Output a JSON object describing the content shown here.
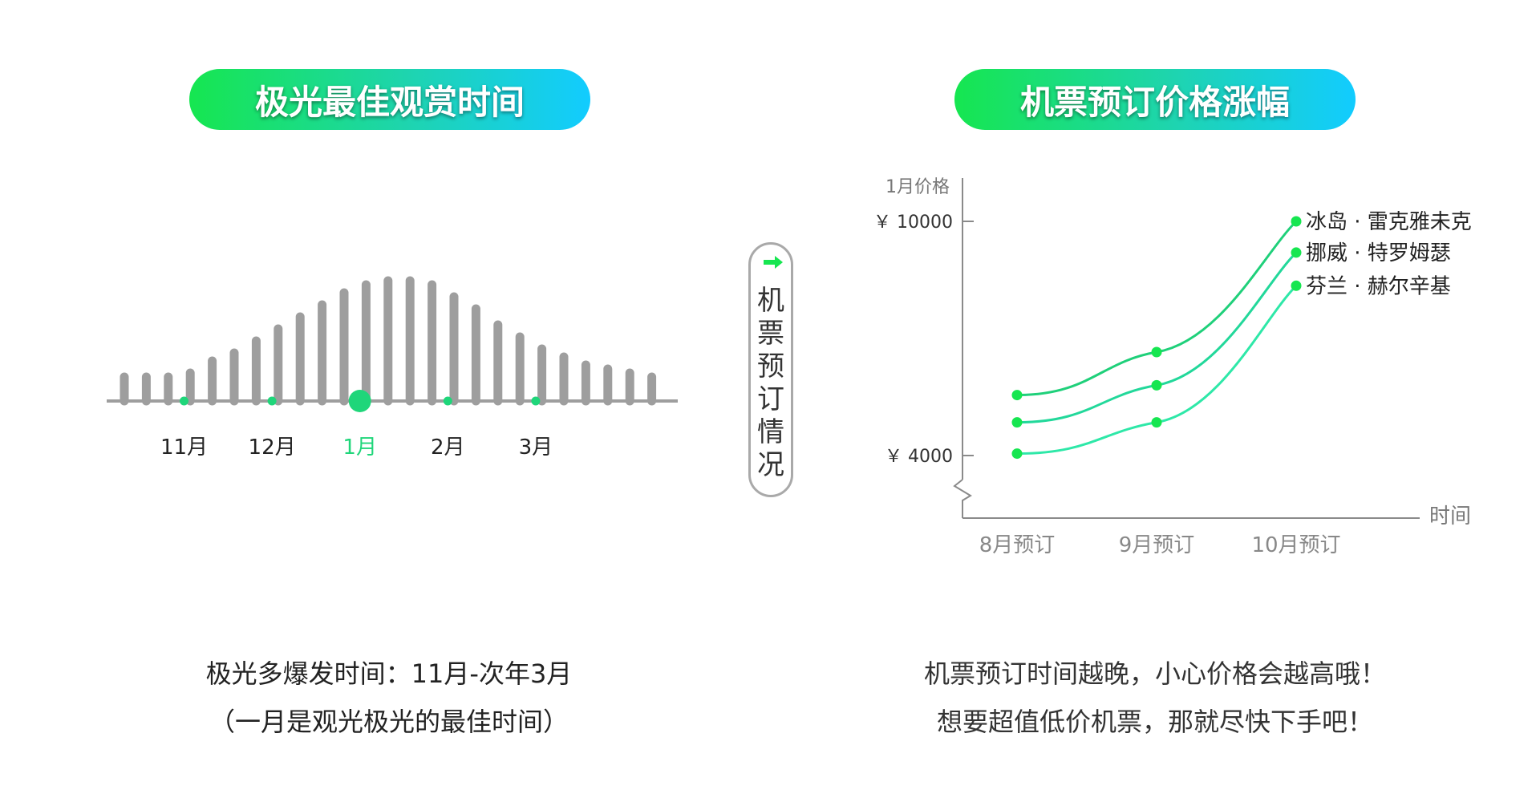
{
  "left_panel": {
    "title": "极光最佳观赏时间",
    "caption_line1": "极光多爆发时间：11月-次年3月",
    "caption_line2": "（一月是观光极光的最佳时间）"
  },
  "right_panel": {
    "title": "机票预订价格涨幅",
    "caption_line1": "机票预订时间越晚，小心价格会越高哦！",
    "caption_line2": "想要超值低价机票，那就尽快下手吧！"
  },
  "badge": {
    "text": "机票预订情况",
    "icon": "arrow-right-icon"
  },
  "colors": {
    "accent": "#16e650",
    "cyan": "#12ccff",
    "bar": "#9e9e9e",
    "highlight": "#1fd67a"
  },
  "chart_data": [
    {
      "type": "bar",
      "title": "极光最佳观赏时间",
      "month_labels": [
        "11月",
        "12月",
        "1月",
        "2月",
        "3月"
      ],
      "highlighted_month": "1月",
      "values": [
        3,
        3,
        3,
        3.5,
        5,
        6,
        7.5,
        9,
        10.5,
        12,
        13.5,
        14.5,
        15,
        15,
        14.5,
        13,
        11.5,
        9.5,
        8,
        6.5,
        5.5,
        4.5,
        4,
        3.5,
        3
      ],
      "ylim": [
        0,
        16
      ]
    },
    {
      "type": "line",
      "title": "机票预订价格涨幅",
      "ylabel": "1月价格",
      "xlabel": "时间",
      "y_ticks": [
        {
          "value": 4000,
          "label": "￥ 4000"
        },
        {
          "value": 10000,
          "label": "￥ 10000"
        }
      ],
      "categories": [
        "8月预订",
        "9月预订",
        "10月预订"
      ],
      "ylim": [
        2500,
        11000
      ],
      "series": [
        {
          "name": "冰岛 · 雷克雅未克",
          "values": [
            5550,
            6650,
            10000
          ]
        },
        {
          "name": "挪威 · 特罗姆瑟",
          "values": [
            4850,
            5800,
            9200
          ]
        },
        {
          "name": "芬兰 · 赫尔辛基",
          "values": [
            4050,
            4850,
            8350
          ]
        }
      ]
    }
  ]
}
